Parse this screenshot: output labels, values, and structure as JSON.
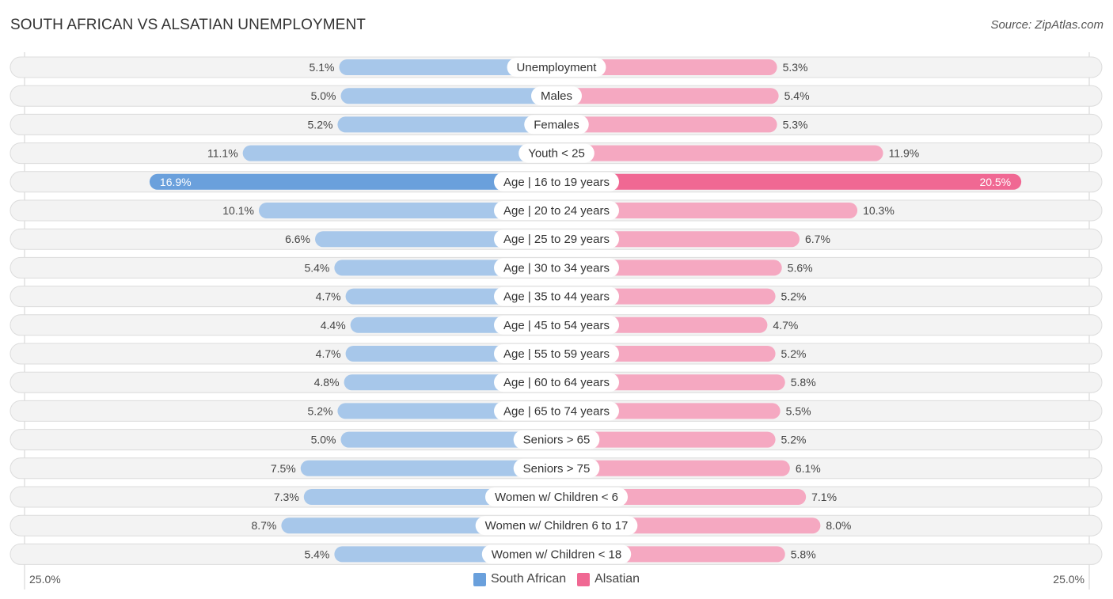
{
  "header": {
    "title": "SOUTH AFRICAN VS ALSATIAN UNEMPLOYMENT",
    "source": "Source: ZipAtlas.com"
  },
  "colors": {
    "south_african": "#a7c7ea",
    "south_african_strong": "#6aa0dc",
    "alsatian": "#f5a8c1",
    "alsatian_strong": "#f06893"
  },
  "chart_data": {
    "type": "bar",
    "orientation": "horizontal-diverging",
    "title": "SOUTH AFRICAN VS ALSATIAN UNEMPLOYMENT",
    "xlabel": "",
    "ylabel": "",
    "xlim": [
      0,
      25.0
    ],
    "axis_min_label": "25.0%",
    "axis_max_label": "25.0%",
    "legend_position": "bottom-center",
    "categories": [
      "Unemployment",
      "Males",
      "Females",
      "Youth < 25",
      "Age | 16 to 19 years",
      "Age | 20 to 24 years",
      "Age | 25 to 29 years",
      "Age | 30 to 34 years",
      "Age | 35 to 44 years",
      "Age | 45 to 54 years",
      "Age | 55 to 59 years",
      "Age | 60 to 64 years",
      "Age | 65 to 74 years",
      "Seniors > 65",
      "Seniors > 75",
      "Women w/ Children < 6",
      "Women w/ Children 6 to 17",
      "Women w/ Children < 18"
    ],
    "series": [
      {
        "name": "South African",
        "side": "left",
        "values": [
          5.1,
          5.0,
          5.2,
          11.1,
          16.9,
          10.1,
          6.6,
          5.4,
          4.7,
          4.4,
          4.7,
          4.8,
          5.2,
          5.0,
          7.5,
          7.3,
          8.7,
          5.4
        ],
        "labels": [
          "5.1%",
          "5.0%",
          "5.2%",
          "11.1%",
          "16.9%",
          "10.1%",
          "6.6%",
          "5.4%",
          "4.7%",
          "4.4%",
          "4.7%",
          "4.8%",
          "5.2%",
          "5.0%",
          "7.5%",
          "7.3%",
          "8.7%",
          "5.4%"
        ]
      },
      {
        "name": "Alsatian",
        "side": "right",
        "values": [
          5.3,
          5.4,
          5.3,
          11.9,
          20.5,
          10.3,
          6.7,
          5.6,
          5.2,
          4.7,
          5.2,
          5.8,
          5.5,
          5.2,
          6.1,
          7.1,
          8.0,
          5.8
        ],
        "labels": [
          "5.3%",
          "5.4%",
          "5.3%",
          "11.9%",
          "20.5%",
          "10.3%",
          "6.7%",
          "5.6%",
          "5.2%",
          "4.7%",
          "5.2%",
          "5.8%",
          "5.5%",
          "5.2%",
          "6.1%",
          "7.1%",
          "8.0%",
          "5.8%"
        ]
      }
    ],
    "highlighted_category": "Age | 16 to 19 years"
  },
  "legend": {
    "items": [
      {
        "label": "South African",
        "color": "#6aa0dc"
      },
      {
        "label": "Alsatian",
        "color": "#f06893"
      }
    ]
  }
}
